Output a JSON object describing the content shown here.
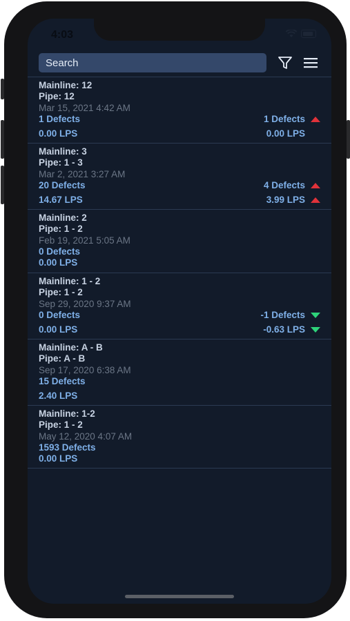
{
  "status": {
    "time": "4:03"
  },
  "search": {
    "placeholder": "Search",
    "value": ""
  },
  "toolbar": {
    "filter_icon": "filter-icon",
    "menu_icon": "hamburger-menu-icon"
  },
  "colors": {
    "up": "#e0323a",
    "down": "#2ed37a",
    "accent": "#7fb0e8",
    "background": "#121b2a"
  },
  "items": [
    {
      "mainline": "Mainline: 12",
      "pipe": "Pipe: 12",
      "date": "Mar 15, 2021 4:42 AM",
      "defects": "1 Defects",
      "lps": "0.00 LPS",
      "defects_change": "1 Defects",
      "defects_trend": "up",
      "lps_change": "0.00 LPS",
      "lps_trend": ""
    },
    {
      "mainline": "Mainline: 3",
      "pipe": "Pipe: 1 - 3",
      "date": "Mar 2, 2021 3:27 AM",
      "defects": "20 Defects",
      "lps": "14.67 LPS",
      "defects_change": "4 Defects",
      "defects_trend": "up",
      "lps_change": "3.99 LPS",
      "lps_trend": "up"
    },
    {
      "mainline": "Mainline: 2",
      "pipe": "Pipe: 1 - 2",
      "date": "Feb 19, 2021 5:05 AM",
      "defects": "0 Defects",
      "lps": "0.00 LPS"
    },
    {
      "mainline": "Mainline: 1 - 2",
      "pipe": "Pipe: 1 - 2",
      "date": "Sep 29, 2020 9:37 AM",
      "defects": "0 Defects",
      "lps": "0.00 LPS",
      "defects_change": "-1 Defects",
      "defects_trend": "down",
      "lps_change": "-0.63 LPS",
      "lps_trend": "down"
    },
    {
      "mainline": "Mainline: A - B",
      "pipe": "Pipe: A - B",
      "date": "Sep 17, 2020 6:38 AM",
      "defects": "15 Defects",
      "lps": "2.40 LPS"
    },
    {
      "mainline": "Mainline: 1-2",
      "pipe": "Pipe: 1 - 2",
      "date": "May 12, 2020 4:07 AM",
      "defects": "1593 Defects",
      "lps": "0.00 LPS"
    }
  ]
}
